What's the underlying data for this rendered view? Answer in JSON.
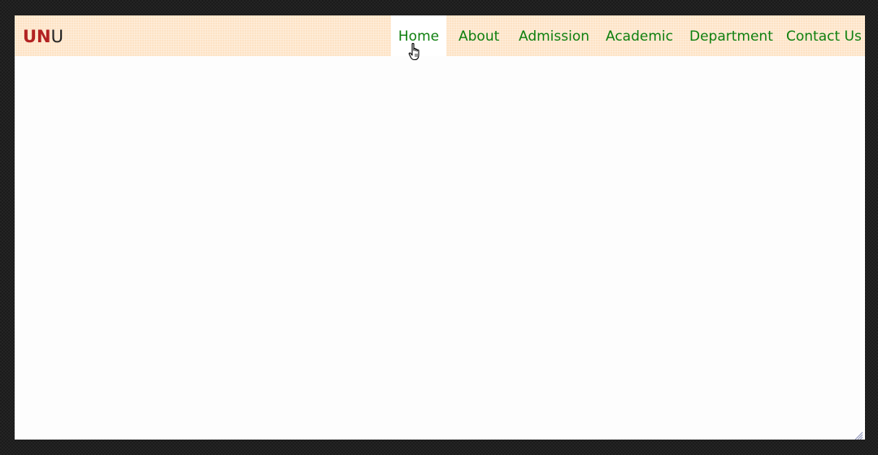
{
  "brand": {
    "accent": "UN",
    "rest": "U",
    "accent_color": "#b22222"
  },
  "nav": {
    "items": [
      {
        "label": "Home",
        "active": true
      },
      {
        "label": "About"
      },
      {
        "label": "Admission"
      },
      {
        "label": "Academic"
      },
      {
        "label": "Department"
      },
      {
        "label": "Contact Us"
      }
    ],
    "link_color": "#0e7f0e",
    "bar_color": "#fde3c5"
  },
  "cursor": {
    "icon": "hand-pointer-icon"
  },
  "window": {
    "resize_icon": "resize-grip-icon"
  }
}
